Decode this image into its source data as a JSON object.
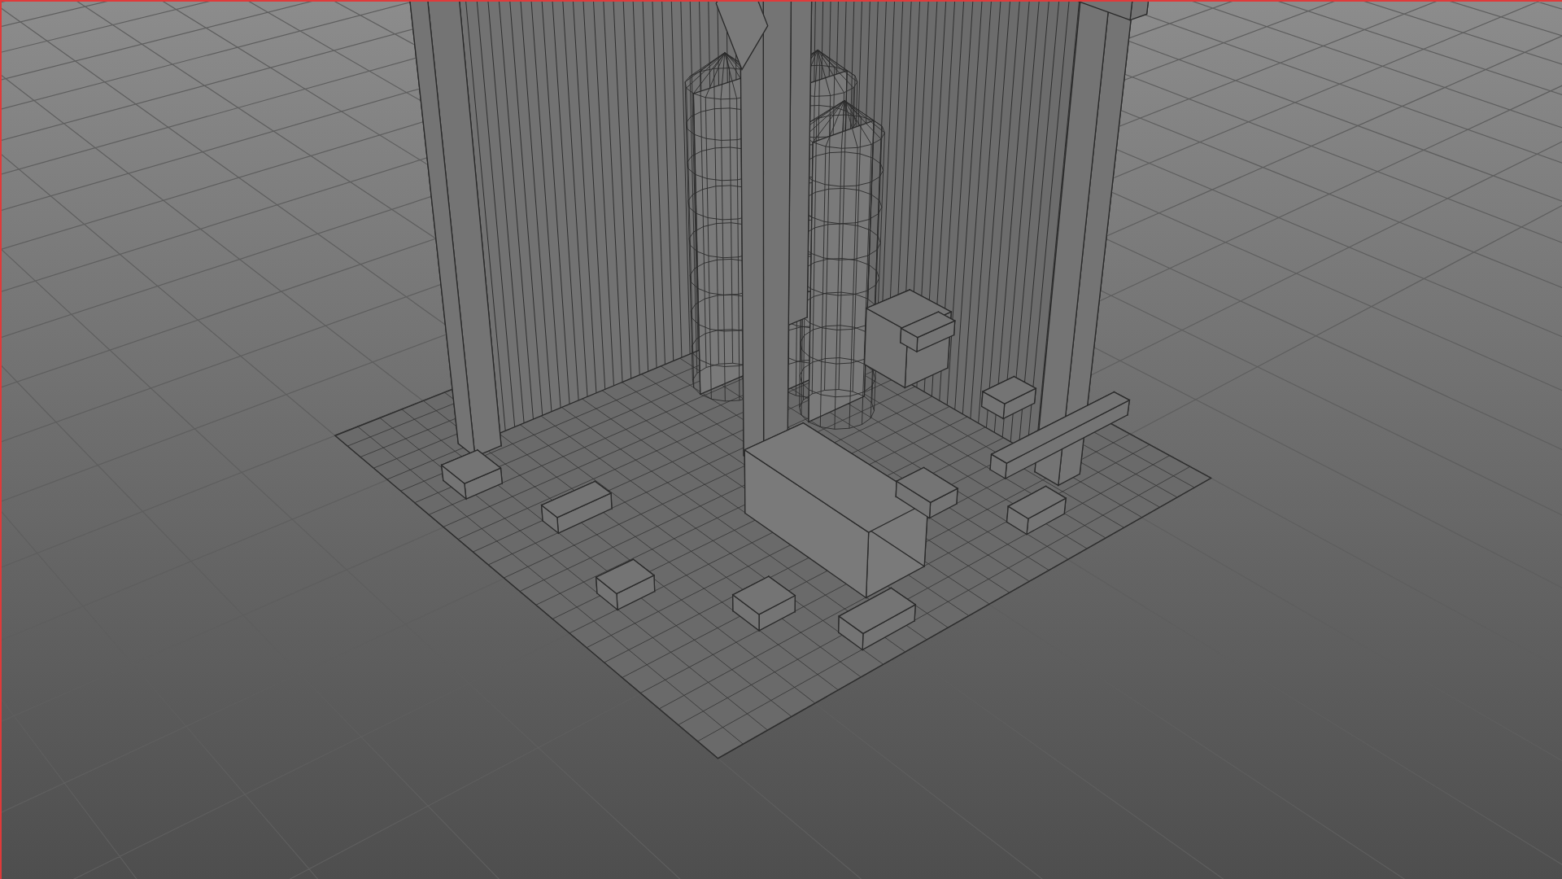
{
  "viewport": {
    "active": true
  }
}
